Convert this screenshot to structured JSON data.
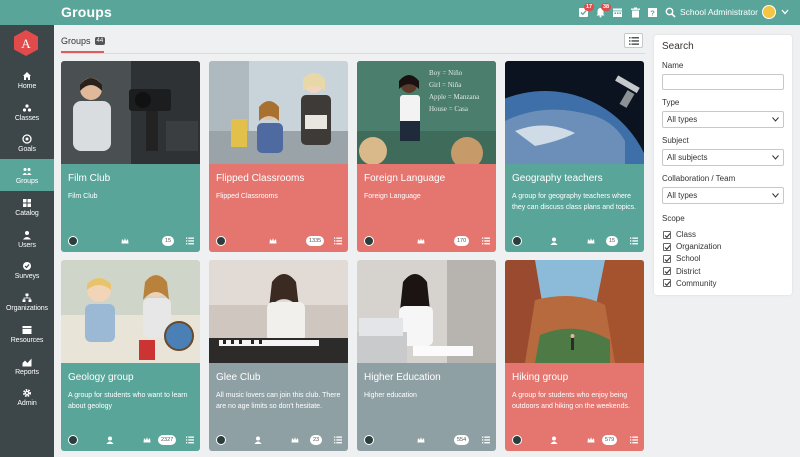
{
  "topbar": {
    "title": "Groups",
    "notif_badge_1": "17",
    "notif_badge_2": "38",
    "user_name": "School Administrator"
  },
  "sidebar": {
    "items": [
      {
        "label": "Home",
        "icon": "home-icon"
      },
      {
        "label": "Classes",
        "icon": "classes-icon"
      },
      {
        "label": "Goals",
        "icon": "goals-icon"
      },
      {
        "label": "Groups",
        "icon": "groups-icon",
        "active": true
      },
      {
        "label": "Catalog",
        "icon": "catalog-icon"
      },
      {
        "label": "Users",
        "icon": "users-icon"
      },
      {
        "label": "Surveys",
        "icon": "surveys-icon"
      },
      {
        "label": "Organizations",
        "icon": "organizations-icon"
      },
      {
        "label": "Resources",
        "icon": "resources-icon"
      },
      {
        "label": "Reports",
        "icon": "reports-icon"
      },
      {
        "label": "Admin",
        "icon": "admin-icon"
      }
    ]
  },
  "main": {
    "tab_label": "Groups",
    "tab_count": "44"
  },
  "groups": [
    {
      "title": "Film Club",
      "description": "Film Club",
      "count": "15",
      "color": "#5aa59a"
    },
    {
      "title": "Flipped Classrooms",
      "description": "Flipped Classrooms",
      "count": "1335",
      "color": "#e5756f"
    },
    {
      "title": "Foreign Language",
      "description": "Foreign Language",
      "count": "170",
      "color": "#e5756f"
    },
    {
      "title": "Geography teachers",
      "description": "A group for geography teachers where they can discuss class plans and topics.",
      "count": "15",
      "color": "#5aa59a"
    },
    {
      "title": "Geology group",
      "description": "A group for students who want to learn about geology",
      "count": "2327",
      "color": "#5aa59a"
    },
    {
      "title": "Glee Club",
      "description": "All music lovers can join this club. There are no age limits so don't hesitate.",
      "count": "23",
      "color": "#8fa0a4"
    },
    {
      "title": "Higher Education",
      "description": "Higher education",
      "count": "554",
      "color": "#8fa0a4"
    },
    {
      "title": "Hiking group",
      "description": "A group for students who enjoy being outdoors and hiking on the weekends.",
      "count": "579",
      "color": "#e5756f"
    }
  ],
  "search": {
    "title": "Search",
    "name_label": "Name",
    "name_value": "",
    "type_label": "Type",
    "type_value": "All types",
    "subject_label": "Subject",
    "subject_value": "All subjects",
    "collab_label": "Collaboration / Team",
    "collab_value": "All types",
    "scope_label": "Scope",
    "scope": [
      "Class",
      "Organization",
      "School",
      "District",
      "Community"
    ]
  }
}
